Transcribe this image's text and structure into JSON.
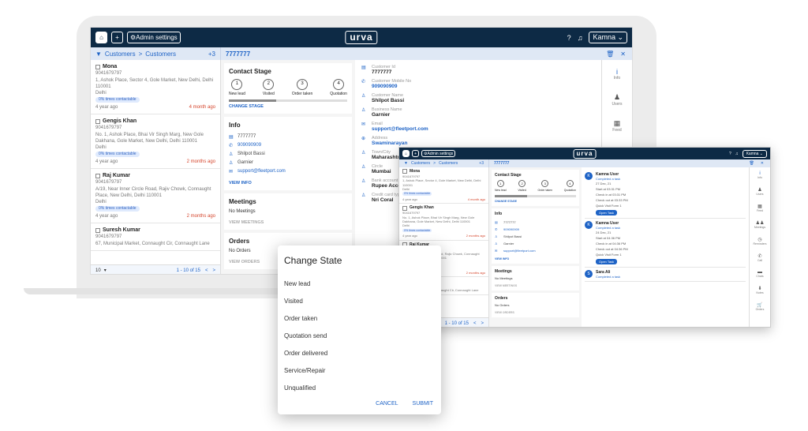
{
  "topbar": {
    "home_icon": "home-icon",
    "add_icon": "plus-icon",
    "admin_label": "Admin settings",
    "logo": "urva",
    "help_icon": "help-icon",
    "bell_icon": "bell-icon",
    "account_label": "Kamna ⌄"
  },
  "subbar": {
    "crumb1": "Customers",
    "sep": ">",
    "crumb2": "Customers",
    "count": "+3",
    "record": "7777777"
  },
  "customers": [
    {
      "name": "Mona",
      "phone": "9041679797",
      "address": "1, Ashok Place, Sector 4, Gole Market, New Delhi, Delhi 110001",
      "city": "Delhi",
      "pill": "0% times contactable",
      "age": "4 year ago",
      "last": "4 month ago"
    },
    {
      "name": "Gengis Khan",
      "phone": "9041679797",
      "address": "No. 1, Ashok Place, Bhai Vir Singh Marg, New Gole Dakhana, Gole Market, New Delhi, Delhi 110001",
      "city": "Delhi",
      "pill": "0% times contactable",
      "age": "4 year ago",
      "last": "2 months ago"
    },
    {
      "name": "Raj Kumar",
      "phone": "9041679797",
      "address": "A/19, Near Inner Circle Road, Rajiv Chowk, Connaught Place, New Delhi, Delhi 110001",
      "city": "Delhi",
      "pill": "0% times contactable",
      "age": "4 year ago",
      "last": "2 months ago"
    },
    {
      "name": "Suresh Kumar",
      "phone": "9041679797",
      "address": "67, Municipal Market, Connaught Cir, Connaught Lane",
      "city": "",
      "pill": "",
      "age": "",
      "last": ""
    }
  ],
  "pager": {
    "size": "10",
    "range": "1 - 10 of 15"
  },
  "stage": {
    "title": "Contact Stage",
    "steps": [
      {
        "n": "1",
        "label": "New lead"
      },
      {
        "n": "2",
        "label": "Visited"
      },
      {
        "n": "3",
        "label": "Order taken"
      },
      {
        "n": "4",
        "label": "Quotation"
      }
    ],
    "progress": 0.4,
    "change": "CHANGE STAGE"
  },
  "info": {
    "title": "Info",
    "id": "7777777",
    "phone": "909090909",
    "name": "Shilpot Bassi",
    "business": "Garnier",
    "email": "support@fleetport.com",
    "view": "VIEW INFO"
  },
  "meetings": {
    "title": "Meetings",
    "empty": "No Meetings",
    "view": "VIEW MEETINGS"
  },
  "orders": {
    "title": "Orders",
    "empty": "No Orders",
    "view": "VIEW ORDERS"
  },
  "details": [
    {
      "label": "Customer Id",
      "value": "7777777",
      "link": false
    },
    {
      "label": "Customer Mobile No",
      "value": "909090909",
      "link": true
    },
    {
      "label": "Customer Name",
      "value": "Shilpot Bassi",
      "link": false
    },
    {
      "label": "Business Name",
      "value": "Garnier",
      "link": false
    },
    {
      "label": "Email",
      "value": "support@fleetport.com",
      "link": true
    },
    {
      "label": "Address",
      "value": "Swaminarayan",
      "link": true
    },
    {
      "label": "Town/City",
      "value": "Maharashtra",
      "link": false
    },
    {
      "label": "Circle",
      "value": "Mumbai",
      "link": false
    },
    {
      "label": "Bank account",
      "value": "Rupee Account",
      "link": false
    },
    {
      "label": "Credit card type",
      "value": "Nri Coral",
      "link": false
    }
  ],
  "rail": [
    {
      "icon": "i",
      "label": "Info"
    },
    {
      "icon": "♟",
      "label": "Users"
    },
    {
      "icon": "▦",
      "label": "Feed"
    }
  ],
  "rail2": [
    {
      "icon": "i",
      "label": "Info"
    },
    {
      "icon": "♟",
      "label": "Users"
    },
    {
      "icon": "▦",
      "label": "Feed"
    },
    {
      "icon": "♟♟",
      "label": "Meetings"
    },
    {
      "icon": "◷",
      "label": "Reminders"
    },
    {
      "icon": "✆",
      "label": "Call"
    },
    {
      "icon": "▬",
      "label": "Chats"
    },
    {
      "icon": "⬇",
      "label": "Notes"
    },
    {
      "icon": "🛒",
      "label": "Orders"
    }
  ],
  "activities": [
    {
      "avatar": "K",
      "who": "Kamna User",
      "sub": "Completed a task",
      "lines": [
        "27 Dec, 21",
        "Start at 03:31 PM",
        "Check in at 03:31 PM",
        "Check out at 03:33 PM",
        "Quick Visit Form 1"
      ],
      "btn": "Open Task"
    },
    {
      "avatar": "K",
      "who": "Kamna User",
      "sub": "Completed a task",
      "lines": [
        "24 Dec, 21",
        "Start at 04:36 PM",
        "Check in at 04:36 PM",
        "Check out at 04:36 PM",
        "Quick Visit Form 1"
      ],
      "btn": "Open Task"
    },
    {
      "avatar": "S",
      "who": "Sara Ali",
      "sub": "Completed a task",
      "lines": [],
      "btn": ""
    }
  ],
  "dialog": {
    "title": "Change State",
    "options": [
      "New lead",
      "Visited",
      "Order taken",
      "Quotation send",
      "Order delivered",
      "Service/Repair",
      "Unqualified"
    ],
    "cancel": "CANCEL",
    "submit": "SUBMIT"
  }
}
